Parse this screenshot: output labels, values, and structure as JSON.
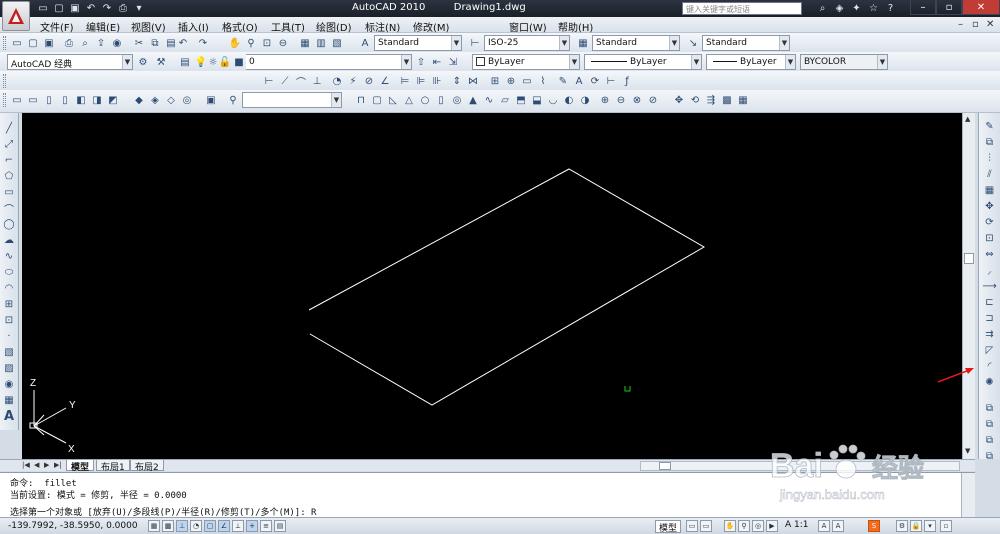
{
  "app": {
    "title": "AutoCAD 2010",
    "document": "Drawing1.dwg",
    "search_placeholder": "键入关键字或短语"
  },
  "menu": [
    "文件(F)",
    "编辑(E)",
    "视图(V)",
    "插入(I)",
    "格式(O)",
    "工具(T)",
    "绘图(D)",
    "标注(N)",
    "修改(M)",
    "窗口(W)",
    "帮助(H)"
  ],
  "styles": {
    "text_style": "Standard",
    "dim_style": "ISO-25",
    "table_style": "Standard",
    "multileader_style": "Standard"
  },
  "workspace": "AutoCAD 经典",
  "layer": "0",
  "properties": {
    "color": "ByLayer",
    "linetype": "ByLayer",
    "lineweight": "ByLayer",
    "plotstyle": "BYCOLOR"
  },
  "ucs": {
    "x": "X",
    "y": "Y",
    "z": "Z"
  },
  "layout_tabs": [
    "模型",
    "布局1",
    "布局2"
  ],
  "command_lines": [
    "命令:  fillet",
    "当前设置: 模式 = 修剪, 半径 = 0.0000",
    "选择第一个对象或 [放弃(U)/多段线(P)/半径(R)/修剪(T)/多个(M)]: R"
  ],
  "status": {
    "coordinates": "-139.7992, -38.5950, 0.0000",
    "model_label": "模型",
    "annotation_scale": "A 1:1"
  },
  "colors": {
    "canvas": "#000000",
    "linework": "#ffffff",
    "annotation_arrow": "#e01818"
  },
  "watermark": {
    "brand": "Bai",
    "brand_cn": "经验",
    "url": "jingyan.baidu.com"
  }
}
